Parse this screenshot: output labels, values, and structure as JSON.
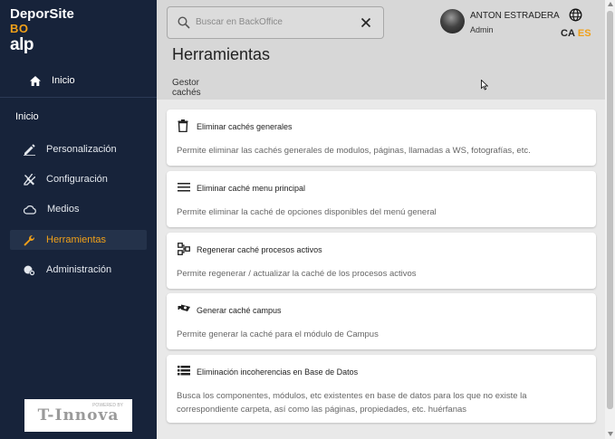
{
  "brand": {
    "name": "DeporSite",
    "sub": "BO",
    "alp": "alp"
  },
  "sidebar": {
    "home_label": "Inicio",
    "section_label": "Inicio",
    "items": [
      {
        "label": "Personalización",
        "icon": "pencil-icon"
      },
      {
        "label": "Configuración",
        "icon": "tools-icon"
      },
      {
        "label": "Medios",
        "icon": "cloud-icon"
      },
      {
        "label": "Herramientas",
        "icon": "wrench-icon",
        "active": true
      },
      {
        "label": "Administración",
        "icon": "admin-settings-icon"
      }
    ],
    "logo_text": "T-Innova",
    "logo_powered": "POWERED BY"
  },
  "header": {
    "search_placeholder": "Buscar en BackOffice",
    "user_name": "ANTON ESTRADERA",
    "user_role": "Admin",
    "lang_ca": "CA",
    "lang_es": "ES",
    "page_title": "Herramientas",
    "tab_label": "Gestor cachés"
  },
  "cards": [
    {
      "title": "Eliminar cachés generales",
      "desc": "Permite eliminar las cachés generales de modulos, páginas, llamadas a WS, fotografías, etc.",
      "icon": "trash-icon"
    },
    {
      "title": "Eliminar caché menu principal",
      "desc": "Permite eliminar la caché de opciones disponibles del menú general",
      "icon": "menu-icon"
    },
    {
      "title": "Regenerar caché procesos activos",
      "desc": "Permite regenerar / actualizar la caché de los procesos activos",
      "icon": "process-icon"
    },
    {
      "title": "Generar caché campus",
      "desc": "Permite generar la caché para el módulo de Campus",
      "icon": "campus-icon"
    },
    {
      "title": "Eliminación incoherencias en Base de Datos",
      "desc": "Busca los componentes, módulos, etc existentes en base de datos para los que no existe la correspondiente carpeta, así como las páginas, propiedades, etc. huérfanas",
      "icon": "list-icon"
    }
  ],
  "colors": {
    "sidebar_bg": "#17233a",
    "accent": "#f0a019",
    "header_bg": "#d7d7d7"
  }
}
